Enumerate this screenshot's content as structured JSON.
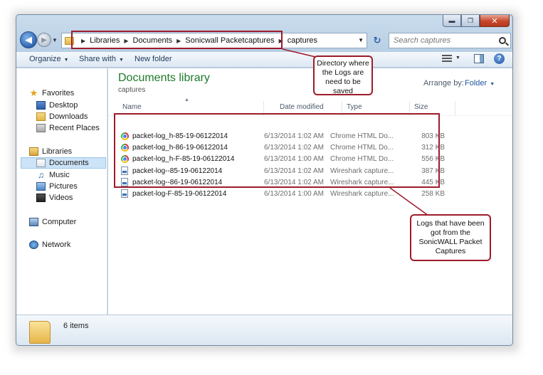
{
  "window": {
    "caption_buttons": {
      "minimize": "▬",
      "maximize": "❐",
      "close": "✕"
    }
  },
  "address_bar": {
    "crumbs": [
      "Libraries",
      "Documents",
      "Sonicwall Packetcaptures",
      "captures"
    ],
    "search_placeholder": "Search captures"
  },
  "toolbar": {
    "organize": "Organize",
    "share_with": "Share with",
    "new_folder": "New folder"
  },
  "nav": {
    "favorites": "Favorites",
    "desktop": "Desktop",
    "downloads": "Downloads",
    "recent": "Recent Places",
    "libraries": "Libraries",
    "documents": "Documents",
    "music": "Music",
    "pictures": "Pictures",
    "videos": "Videos",
    "computer": "Computer",
    "network": "Network"
  },
  "content": {
    "title": "Documents library",
    "subtitle": "captures",
    "arrange_by_label": "Arrange by:",
    "arrange_by_value": "Folder",
    "columns": {
      "name": "Name",
      "date": "Date modified",
      "type": "Type",
      "size": "Size"
    },
    "files": [
      {
        "name": "packet-log_h-85-19-06122014",
        "date": "6/13/2014 1:02 AM",
        "type": "Chrome HTML Do...",
        "size": "803 KB",
        "icon": "chrome-icon"
      },
      {
        "name": "packet-log_h-86-19-06122014",
        "date": "6/13/2014 1:02 AM",
        "type": "Chrome HTML Do...",
        "size": "312 KB",
        "icon": "chrome-icon"
      },
      {
        "name": "packet-log_h-F-85-19-06122014",
        "date": "6/13/2014 1:00 AM",
        "type": "Chrome HTML Do...",
        "size": "556 KB",
        "icon": "chrome-icon"
      },
      {
        "name": "packet-log--85-19-06122014",
        "date": "6/13/2014 1:02 AM",
        "type": "Wireshark capture...",
        "size": "387 KB",
        "icon": "wireshark-file-icon"
      },
      {
        "name": "packet-log--86-19-06122014",
        "date": "6/13/2014 1:02 AM",
        "type": "Wireshark capture...",
        "size": "445 KB",
        "icon": "wireshark-file-icon"
      },
      {
        "name": "packet-log-F-85-19-06122014",
        "date": "6/13/2014 1:00 AM",
        "type": "Wireshark capture...",
        "size": "258 KB",
        "icon": "wireshark-file-icon"
      }
    ]
  },
  "details": {
    "count": "6 items"
  },
  "callouts": {
    "directory": [
      "Directory where",
      "the Logs are",
      "need to be",
      "saved"
    ],
    "logs": [
      "Logs that have been",
      "got from the",
      "SonicWALL Packet",
      "Captures"
    ]
  },
  "colors": {
    "highlight": "#9e1b2a",
    "library_title": "#1e7a2a",
    "link": "#1f55a0"
  }
}
